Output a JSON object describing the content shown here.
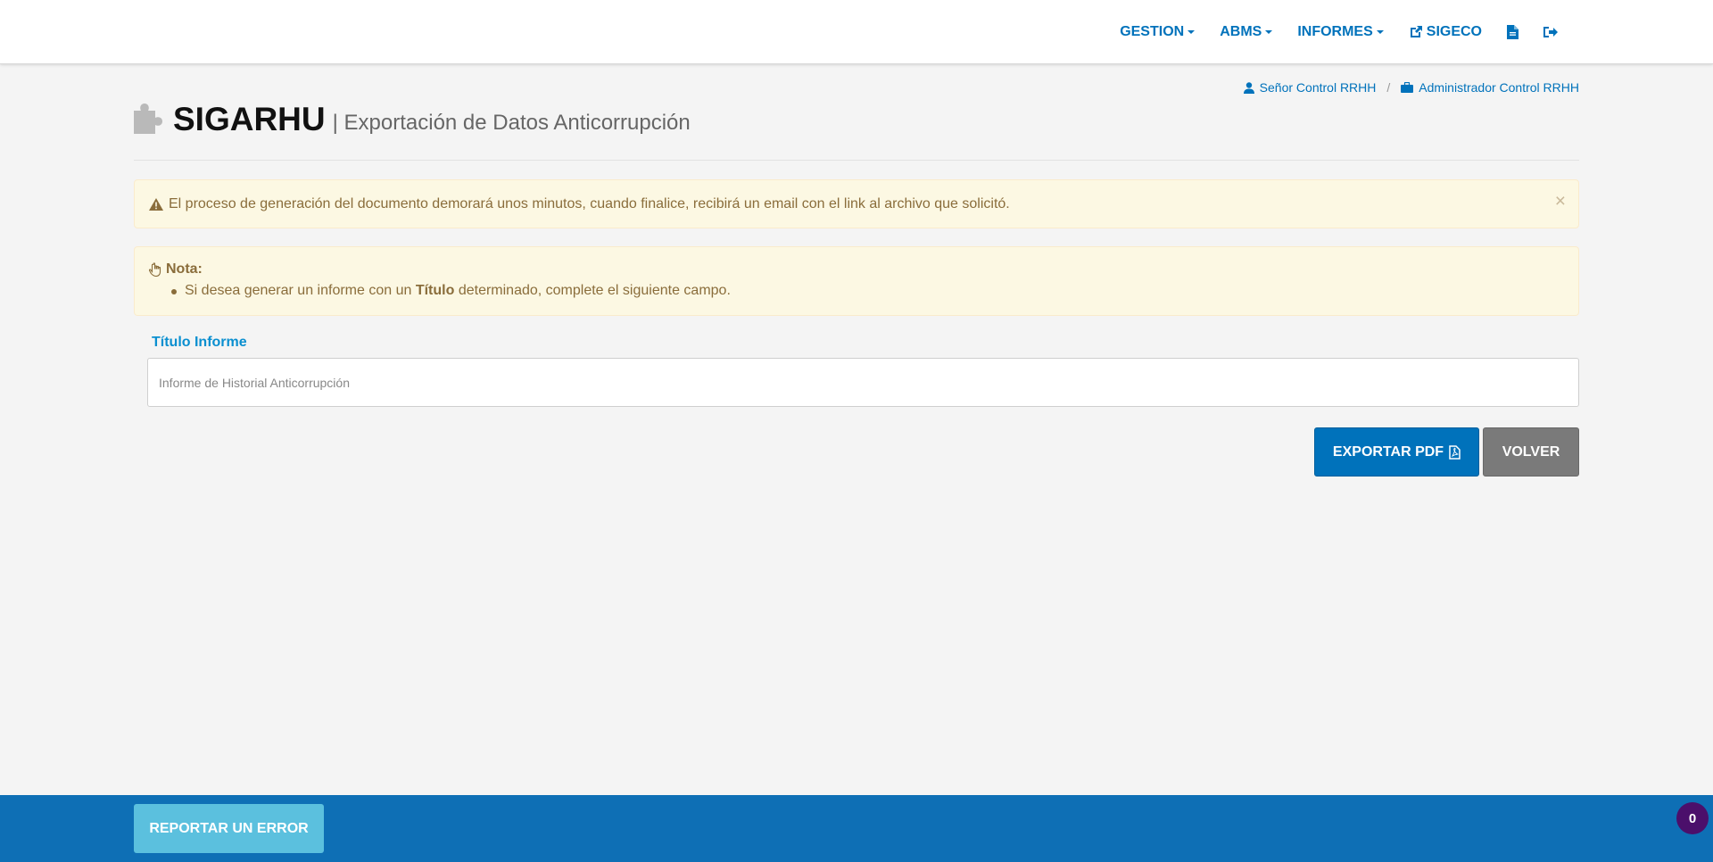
{
  "nav": {
    "items": [
      {
        "label": "GESTION",
        "dropdown": true
      },
      {
        "label": "ABMS",
        "dropdown": true
      },
      {
        "label": "INFORMES",
        "dropdown": true
      },
      {
        "label": "SIGECO",
        "icon": "external-link-icon"
      }
    ],
    "icons": [
      "document-icon",
      "sign-out-icon"
    ],
    "accent_color": "#0072bb"
  },
  "breadcrumb": {
    "user": "Señor Control RRHH",
    "separator": "/",
    "role": "Administrador Control RRHH"
  },
  "header": {
    "title": "SIGARHU",
    "subtitle": "| Exportación de Datos Anticorrupción"
  },
  "alert": {
    "message": "El proceso de generación del documento demorará unos minutos, cuando finalice, recibirá un email con el link al archivo que solicitó.",
    "close": "×"
  },
  "note": {
    "title": "Nota:",
    "text_before": "Si desea generar un informe con un ",
    "text_bold": "Título",
    "text_after": " determinado, complete el siguiente campo."
  },
  "form": {
    "label": "Título Informe",
    "placeholder": "Informe de Historial Anticorrupción",
    "value": ""
  },
  "buttons": {
    "export": "EXPORTAR PDF",
    "back": "VOLVER"
  },
  "footer": {
    "report_button": "REPORTAR UN ERROR",
    "counter": "0"
  }
}
